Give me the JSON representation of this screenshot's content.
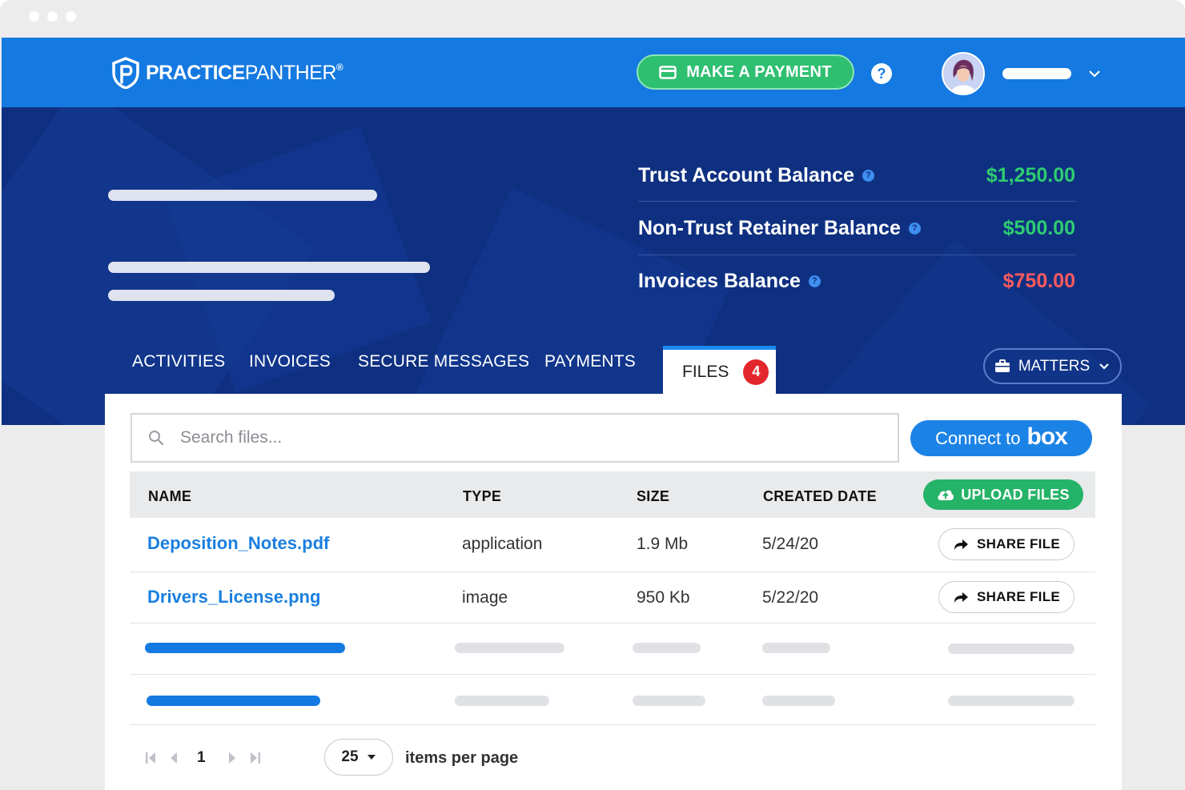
{
  "brand": {
    "name_bold": "PRACTICE",
    "name_thin": "PANTHER",
    "reg": "®"
  },
  "header": {
    "pay_label": "MAKE A PAYMENT",
    "help_symbol": "?"
  },
  "balances": [
    {
      "label": "Trust Account Balance",
      "value": "$1,250.00",
      "color": "#2ecc71"
    },
    {
      "label": "Non-Trust Retainer Balance",
      "value": "$500.00",
      "color": "#2ecc71"
    },
    {
      "label": "Invoices Balance",
      "value": "$750.00",
      "color": "#ff5a5f"
    }
  ],
  "tabs": {
    "activities": "ACTIVITIES",
    "invoices": "INVOICES",
    "secure_messages": "SECURE MESSAGES",
    "payments": "PAYMENTS",
    "files": "FILES",
    "files_badge": "4"
  },
  "matters_label": "MATTERS",
  "search": {
    "placeholder": "Search files..."
  },
  "box": {
    "prefix": "Connect to",
    "logo": "box"
  },
  "table": {
    "headers": {
      "name": "NAME",
      "type": "TYPE",
      "size": "SIZE",
      "created": "CREATED DATE"
    },
    "upload_label": "UPLOAD FILES",
    "share_label": "SHARE FILE",
    "rows": [
      {
        "name": "Deposition_Notes.pdf",
        "type": "application",
        "size": "1.9 Mb",
        "created": "5/24/20"
      },
      {
        "name": "Drivers_License.png",
        "type": "image",
        "size": "950 Kb",
        "created": "5/22/20"
      }
    ]
  },
  "pagination": {
    "page": "1",
    "per_page": "25",
    "per_page_label": "items per page"
  },
  "colors": {
    "brand_blue": "#1479e0",
    "hero_navy": "#0f3081",
    "green": "#2fbf71",
    "badge_red": "#e3262d",
    "link_blue": "#1a7fe0"
  },
  "icons": [
    "panther-logo-icon",
    "credit-card-icon",
    "help-icon",
    "chevron-down-icon",
    "briefcase-icon",
    "search-icon",
    "cloud-upload-icon",
    "share-arrow-icon",
    "first-page-icon",
    "prev-page-icon",
    "next-page-icon",
    "last-page-icon",
    "caret-down-icon"
  ]
}
